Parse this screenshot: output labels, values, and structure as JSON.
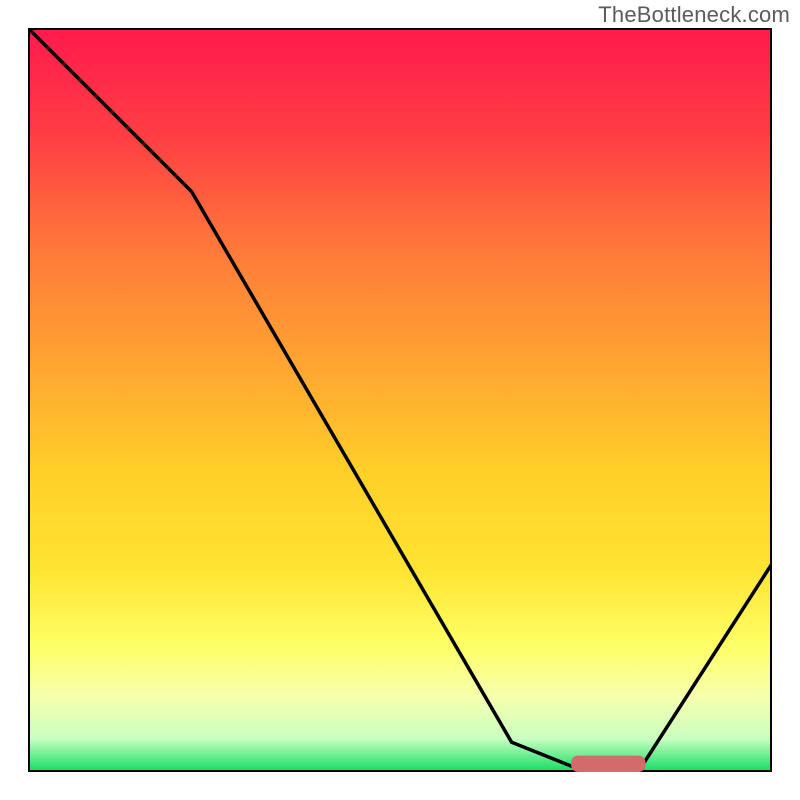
{
  "watermark": "TheBottleneck.com",
  "colors": {
    "gradient_stops": [
      {
        "offset": 0.0,
        "color": "#ff1a4d"
      },
      {
        "offset": 0.15,
        "color": "#ff3f44"
      },
      {
        "offset": 0.3,
        "color": "#ff7a3a"
      },
      {
        "offset": 0.45,
        "color": "#ffa431"
      },
      {
        "offset": 0.6,
        "color": "#ffd028"
      },
      {
        "offset": 0.73,
        "color": "#ffe433"
      },
      {
        "offset": 0.83,
        "color": "#feff66"
      },
      {
        "offset": 0.9,
        "color": "#f6ffae"
      },
      {
        "offset": 0.955,
        "color": "#c9ffc1"
      },
      {
        "offset": 1.0,
        "color": "#12dc62"
      }
    ],
    "line": "#000000",
    "border": "#000000",
    "marker": "#d46a6a"
  },
  "chart_data": {
    "type": "line",
    "title": "",
    "xlabel": "",
    "ylabel": "",
    "xlim": [
      0,
      100
    ],
    "ylim": [
      0,
      100
    ],
    "series": [
      {
        "name": "bottleneck-curve",
        "x": [
          0,
          22,
          65,
          75,
          82,
          100
        ],
        "y": [
          100,
          78,
          4,
          0,
          0,
          28
        ]
      }
    ],
    "marker": {
      "name": "optimal-range",
      "x_start": 73,
      "x_end": 83,
      "y": 0,
      "thickness": 2.2
    }
  }
}
